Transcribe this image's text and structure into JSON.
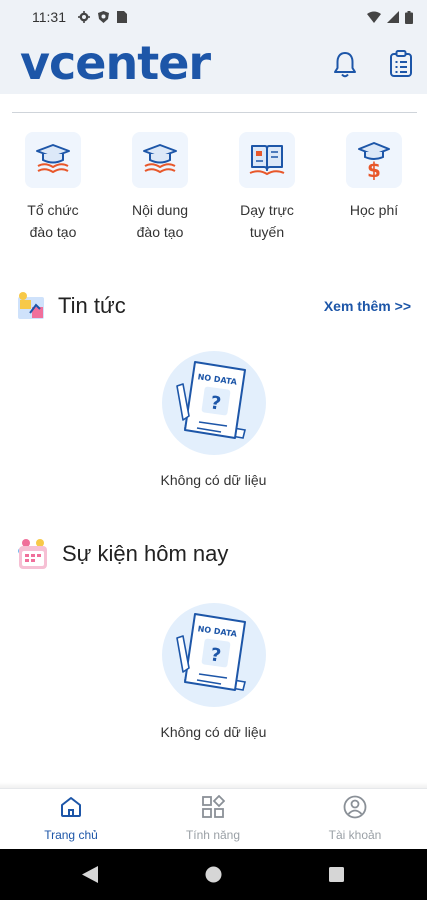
{
  "status_bar": {
    "time": "11:31"
  },
  "app": {
    "logo": "vcenter"
  },
  "features": [
    {
      "label": "Tổ chức\nđào tạo",
      "icon": "graduation-book-icon"
    },
    {
      "label": "Nội dung\nđào tạo",
      "icon": "graduation-book-icon"
    },
    {
      "label": "Dạy trực\ntuyến",
      "icon": "open-book-icon"
    },
    {
      "label": "Học phí",
      "icon": "tuition-fee-icon"
    }
  ],
  "news": {
    "title": "Tin tức",
    "more": "Xem thêm >>",
    "empty_badge": "NO DATA",
    "empty_text": "Không có dữ liệu"
  },
  "events": {
    "title": "Sự kiện hôm nay",
    "empty_badge": "NO DATA",
    "empty_text": "Không có dữ liệu"
  },
  "bottom_nav": [
    {
      "label": "Trang chủ",
      "active": true
    },
    {
      "label": "Tính năng",
      "active": false
    },
    {
      "label": "Tài khoản",
      "active": false
    }
  ],
  "colors": {
    "brand": "#1d56a8",
    "accent": "#e8572a",
    "header_bg": "#eef2f7"
  }
}
